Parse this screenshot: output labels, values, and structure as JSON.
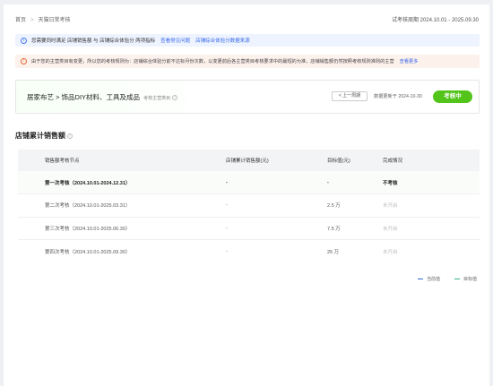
{
  "breadcrumb": {
    "home": "首页",
    "current": "天猫日常考核"
  },
  "assessment_period": "试考核周期 2024.10.01 - 2025.09.30",
  "info_bar": {
    "text": "您需要同时满足 店铺销售额 与 店铺综合体验分 两项指标",
    "link1": "查看常见问题",
    "link2": "店铺综合体验分数据来源"
  },
  "warning_bar": {
    "text": "由于您的主营类目有变更，所以您的考核规则为：店铺综合体验分前不达标月份次数，以变更前后各主营类目考核要求中的最短的为准，店铺销售额仍然按照考核规则准则的主营",
    "link": "查看更多"
  },
  "category_card": {
    "category": "居家布艺 > 饰品DIY材料、工具及成品",
    "category_tag": "考核主营类目",
    "prev_button": "< 上一周期",
    "update_text": "数据更新于 2024-10-30",
    "status": "考核中"
  },
  "section_title": "店铺累计销售额",
  "table": {
    "headers": [
      "销售额考核节点",
      "店铺累计销售额(元)",
      "目标值(元)",
      "完成情况"
    ],
    "rows": [
      {
        "node": "第一次考核（2024.10.01-2024.12.31）",
        "sales": "-",
        "target": "-",
        "status": "不考核",
        "highlight": true
      },
      {
        "node": "第二次考核（2024.10.01-2025.03.31）",
        "sales": "-",
        "target": "2.5 万",
        "status": "未开启",
        "highlight": false
      },
      {
        "node": "第三次考核（2024.10.01-2025.06.30）",
        "sales": "-",
        "target": "7.5 万",
        "status": "未开启",
        "highlight": false
      },
      {
        "node": "第四次考核（2024.10.01-2025.09.30）",
        "sales": "-",
        "target": "25 万",
        "status": "未开启",
        "highlight": false
      }
    ]
  },
  "legend": {
    "current": "当前值",
    "target": "目标值"
  },
  "colors": {
    "accent": "#3a6ae8",
    "success": "#52c41a",
    "warning": "#e46b3a",
    "legend_current": "#2f6bd8",
    "legend_target": "#33b38a"
  },
  "icons": {
    "info": "info-icon",
    "warning": "warning-icon",
    "help": "help-icon",
    "chevron": "chevron-right-icon"
  }
}
